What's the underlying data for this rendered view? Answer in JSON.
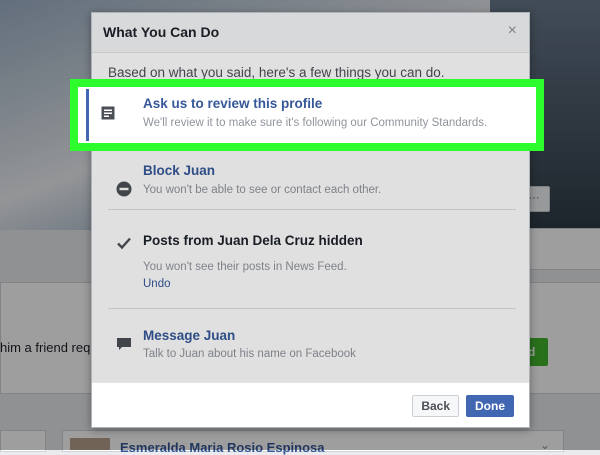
{
  "background": {
    "friend_request_text": "him a friend req",
    "gray_button_label": "···",
    "green_button_label": "d",
    "bottom_name": "Esmeralda Maria Rosio Espinosa"
  },
  "dialog": {
    "title": "What You Can Do",
    "close_symbol": "×",
    "intro": "Based on what you said, here's a few things you can do.",
    "options": [
      {
        "title": "Ask us to review this profile",
        "description": "We'll review it to make sure it's following our Community Standards.",
        "icon": "report-icon"
      },
      {
        "title": "Block Juan",
        "description": "You won't be able to see or contact each other.",
        "icon": "block-icon"
      },
      {
        "title": "Posts from Juan Dela Cruz hidden",
        "description": "You won't see their posts in News Feed.",
        "link": "Undo",
        "icon": "check-icon"
      },
      {
        "title": "Message Juan",
        "description": "Talk to Juan about his name on Facebook",
        "icon": "message-icon"
      }
    ],
    "buttons": {
      "back": "Back",
      "done": "Done"
    }
  },
  "colors": {
    "highlight": "#2dfc2d",
    "link_blue": "#365899",
    "primary_button": "#4267b2"
  }
}
